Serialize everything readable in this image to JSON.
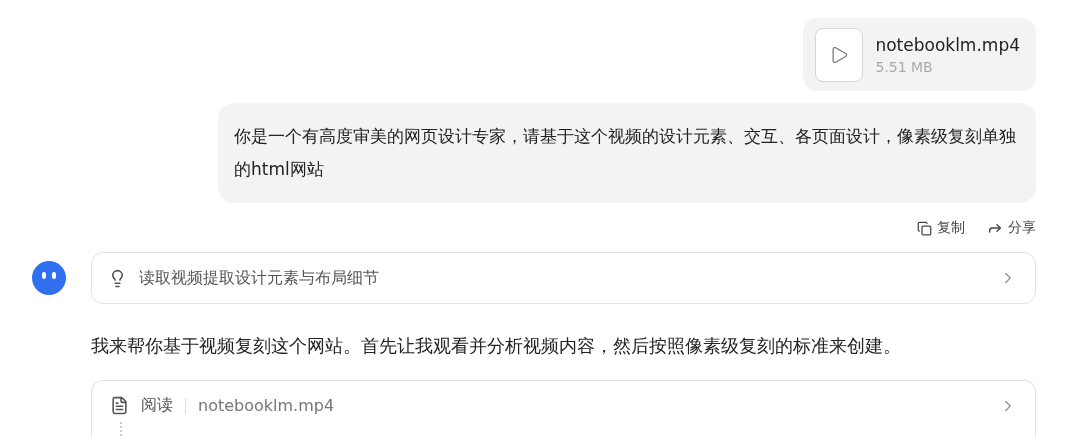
{
  "user_message": {
    "attachment": {
      "name": "notebooklm.mp4",
      "size": "5.51 MB"
    },
    "text": "你是一个有高度审美的网页设计专家，请基于这个视频的设计元素、交互、各页面设计，像素级复刻单独的html网站",
    "actions": [
      {
        "kind": "copy",
        "label": "复制"
      },
      {
        "kind": "share",
        "label": "分享"
      }
    ]
  },
  "assistant": {
    "thinking": {
      "label": "读取视频提取设计元素与布局细节"
    },
    "reply": "我来帮你基于视频复刻这个网站。首先让我观看并分析视频内容，然后按照像素级复刻的标准来创建。",
    "tool_call": {
      "action": "阅读",
      "target": "notebooklm.mp4"
    }
  }
}
